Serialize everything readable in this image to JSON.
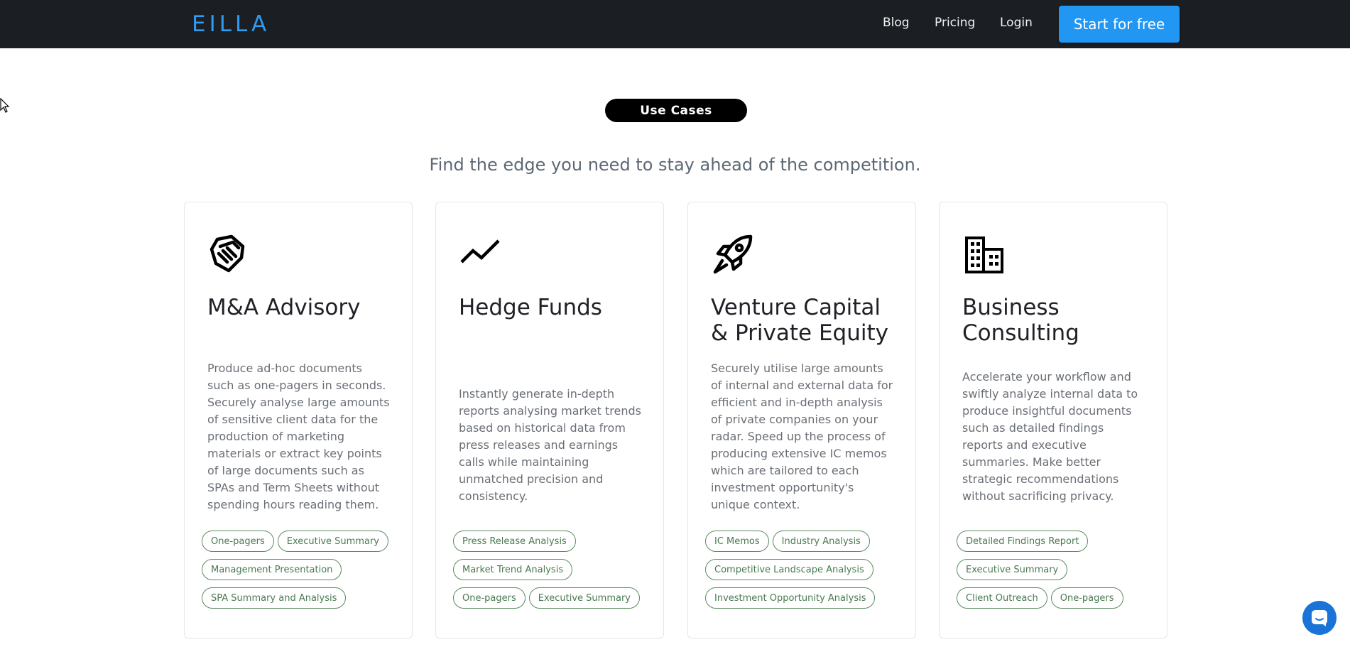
{
  "header": {
    "logo_text": "EILLA",
    "nav": {
      "blog": "Blog",
      "pricing": "Pricing",
      "login": "Login"
    },
    "cta_label": "Start for free"
  },
  "section": {
    "badge": "Use Cases",
    "subtitle": "Find the edge you need to stay ahead of the competition."
  },
  "cards": [
    {
      "icon": "handshake-icon",
      "title": "M&A Advisory",
      "description": "Produce ad-hoc documents such as one-pagers in seconds. Securely analyse large amounts of sensitive client data for the production of marketing materials or extract key points of large documents such as SPAs and Term Sheets without spending hours reading them.",
      "tags": [
        [
          "One-pagers",
          "Executive Summary"
        ],
        [
          "Management Presentation"
        ],
        [
          "SPA Summary and Analysis"
        ]
      ]
    },
    {
      "icon": "trend-line-icon",
      "title": "Hedge Funds",
      "description": "Instantly generate in-depth reports analysing market trends based on historical data from press releases and earnings calls while maintaining unmatched precision and consistency.",
      "tags": [
        [
          "Press Release Analysis"
        ],
        [
          "Market Trend Analysis"
        ],
        [
          "One-pagers",
          "Executive Summary"
        ]
      ]
    },
    {
      "icon": "rocket-icon",
      "title": "Venture Capital & Private Equity",
      "description": "Securely utilise large amounts of internal and external data for efficient and in-depth analysis of private companies on your radar. Speed up the process of producing extensive IC memos which are tailored to each investment opportunity's unique context.",
      "tags": [
        [
          "IC Memos",
          "Industry Analysis"
        ],
        [
          "Competitive Landscape Analysis"
        ],
        [
          "Investment Opportunity Analysis"
        ]
      ]
    },
    {
      "icon": "office-building-icon",
      "title": "Business Consulting",
      "description": "Accelerate your workflow and swiftly analyze internal data to produce insightful documents such as detailed findings reports and executive summaries. Make better strategic recommendations without sacrificing privacy.",
      "tags": [
        [
          "Detailed Findings Report"
        ],
        [
          "Executive Summary"
        ],
        [
          "Client Outreach",
          "One-pagers"
        ]
      ]
    }
  ],
  "colors": {
    "header_bg": "#1b1e23",
    "brand_blue": "#2196f3",
    "tag_green": "#4a7a50",
    "chat_blue": "#1a73d6"
  }
}
